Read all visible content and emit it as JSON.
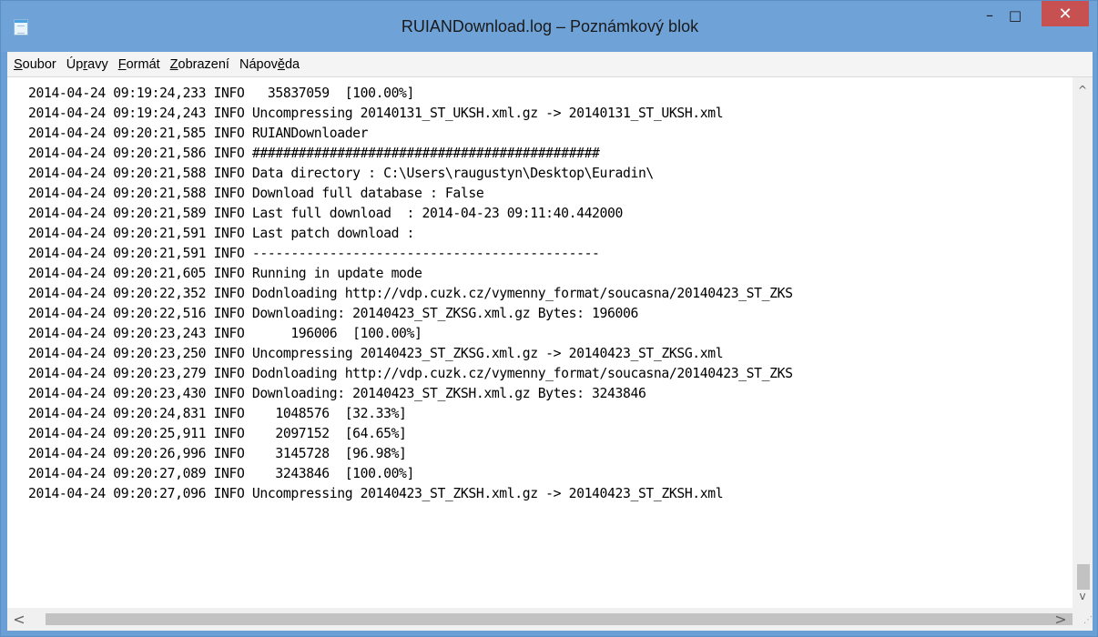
{
  "window": {
    "title": "RUIANDownload.log – Poznámkový blok",
    "controls": {
      "minimize": "–",
      "maximize": "□",
      "close": "✕"
    }
  },
  "menu": [
    {
      "prefix": "",
      "accel": "S",
      "suffix": "oubor"
    },
    {
      "prefix": "Úp",
      "accel": "r",
      "suffix": "avy"
    },
    {
      "prefix": "",
      "accel": "F",
      "suffix": "ormát"
    },
    {
      "prefix": "",
      "accel": "Z",
      "suffix": "obrazení"
    },
    {
      "prefix": "Nápov",
      "accel": "ě",
      "suffix": "da"
    }
  ],
  "log_lines": [
    "2014-04-24 09:19:24,233 INFO   35837059  [100.00%]",
    "2014-04-24 09:19:24,243 INFO Uncompressing 20140131_ST_UKSH.xml.gz -> 20140131_ST_UKSH.xml",
    "2014-04-24 09:20:21,585 INFO RUIANDownloader",
    "2014-04-24 09:20:21,586 INFO #############################################",
    "2014-04-24 09:20:21,588 INFO Data directory : C:\\Users\\raugustyn\\Desktop\\Euradin\\",
    "2014-04-24 09:20:21,588 INFO Download full database : False",
    "2014-04-24 09:20:21,589 INFO Last full download  : 2014-04-23 09:11:40.442000",
    "2014-04-24 09:20:21,591 INFO Last patch download :",
    "2014-04-24 09:20:21,591 INFO ---------------------------------------------",
    "2014-04-24 09:20:21,605 INFO Running in update mode",
    "2014-04-24 09:20:22,352 INFO Dodnloading http://vdp.cuzk.cz/vymenny_format/soucasna/20140423_ST_ZKS",
    "2014-04-24 09:20:22,516 INFO Downloading: 20140423_ST_ZKSG.xml.gz Bytes: 196006",
    "2014-04-24 09:20:23,243 INFO      196006  [100.00%]",
    "2014-04-24 09:20:23,250 INFO Uncompressing 20140423_ST_ZKSG.xml.gz -> 20140423_ST_ZKSG.xml",
    "2014-04-24 09:20:23,279 INFO Dodnloading http://vdp.cuzk.cz/vymenny_format/soucasna/20140423_ST_ZKS",
    "2014-04-24 09:20:23,430 INFO Downloading: 20140423_ST_ZKSH.xml.gz Bytes: 3243846",
    "2014-04-24 09:20:24,831 INFO    1048576  [32.33%]",
    "2014-04-24 09:20:25,911 INFO    2097152  [64.65%]",
    "2014-04-24 09:20:26,996 INFO    3145728  [96.98%]",
    "2014-04-24 09:20:27,089 INFO    3243846  [100.00%]",
    "2014-04-24 09:20:27,096 INFO Uncompressing 20140423_ST_ZKSH.xml.gz -> 20140423_ST_ZKSH.xml"
  ],
  "scrollbars": {
    "vertical": {
      "up": "^",
      "down": "v"
    },
    "horizontal": {
      "left": "<",
      "right": ">"
    },
    "grip": "⋰"
  }
}
